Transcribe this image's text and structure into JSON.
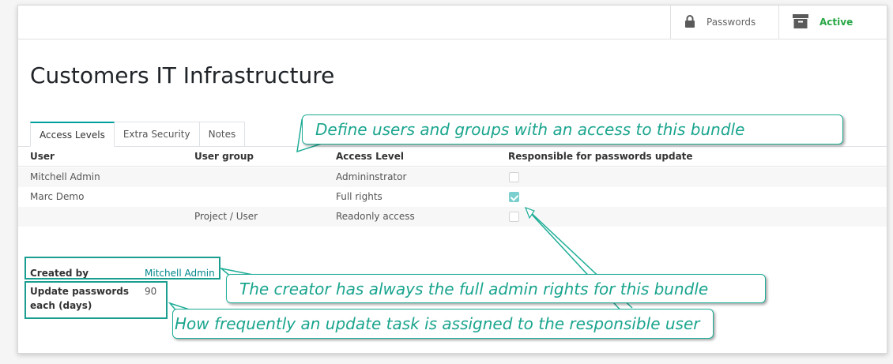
{
  "statusbar": {
    "passwords_label": "Passwords",
    "active_label": "Active"
  },
  "record": {
    "title": "Customers IT Infrastructure"
  },
  "tabs": [
    {
      "label": "Access Levels",
      "active": true
    },
    {
      "label": "Extra Security",
      "active": false
    },
    {
      "label": "Notes",
      "active": false
    }
  ],
  "table": {
    "headers": [
      "User",
      "User group",
      "Access Level",
      "Responsible for passwords update"
    ],
    "rows": [
      {
        "user": "Mitchell Admin",
        "group": "",
        "level": "Admininstrator",
        "responsible": false
      },
      {
        "user": "Marc Demo",
        "group": "",
        "level": "Full rights",
        "responsible": true
      },
      {
        "user": "",
        "group": "Project / User",
        "level": "Readonly access",
        "responsible": false
      }
    ]
  },
  "fields": {
    "created_by_label": "Created by",
    "created_by_value": "Mitchell Admin",
    "update_days_label_1": "Update passwords",
    "update_days_label_2": "each (days)",
    "update_days_value": "90"
  },
  "annotations": {
    "access": "Define users and groups with an access to this bundle",
    "creator": "The creator has always the full admin rights for this bundle",
    "frequency": "How frequently an update task is assigned to the responsible user"
  },
  "colors": {
    "accent": "#00a09d",
    "callout": "#1aa58e",
    "active": "#28a745"
  }
}
